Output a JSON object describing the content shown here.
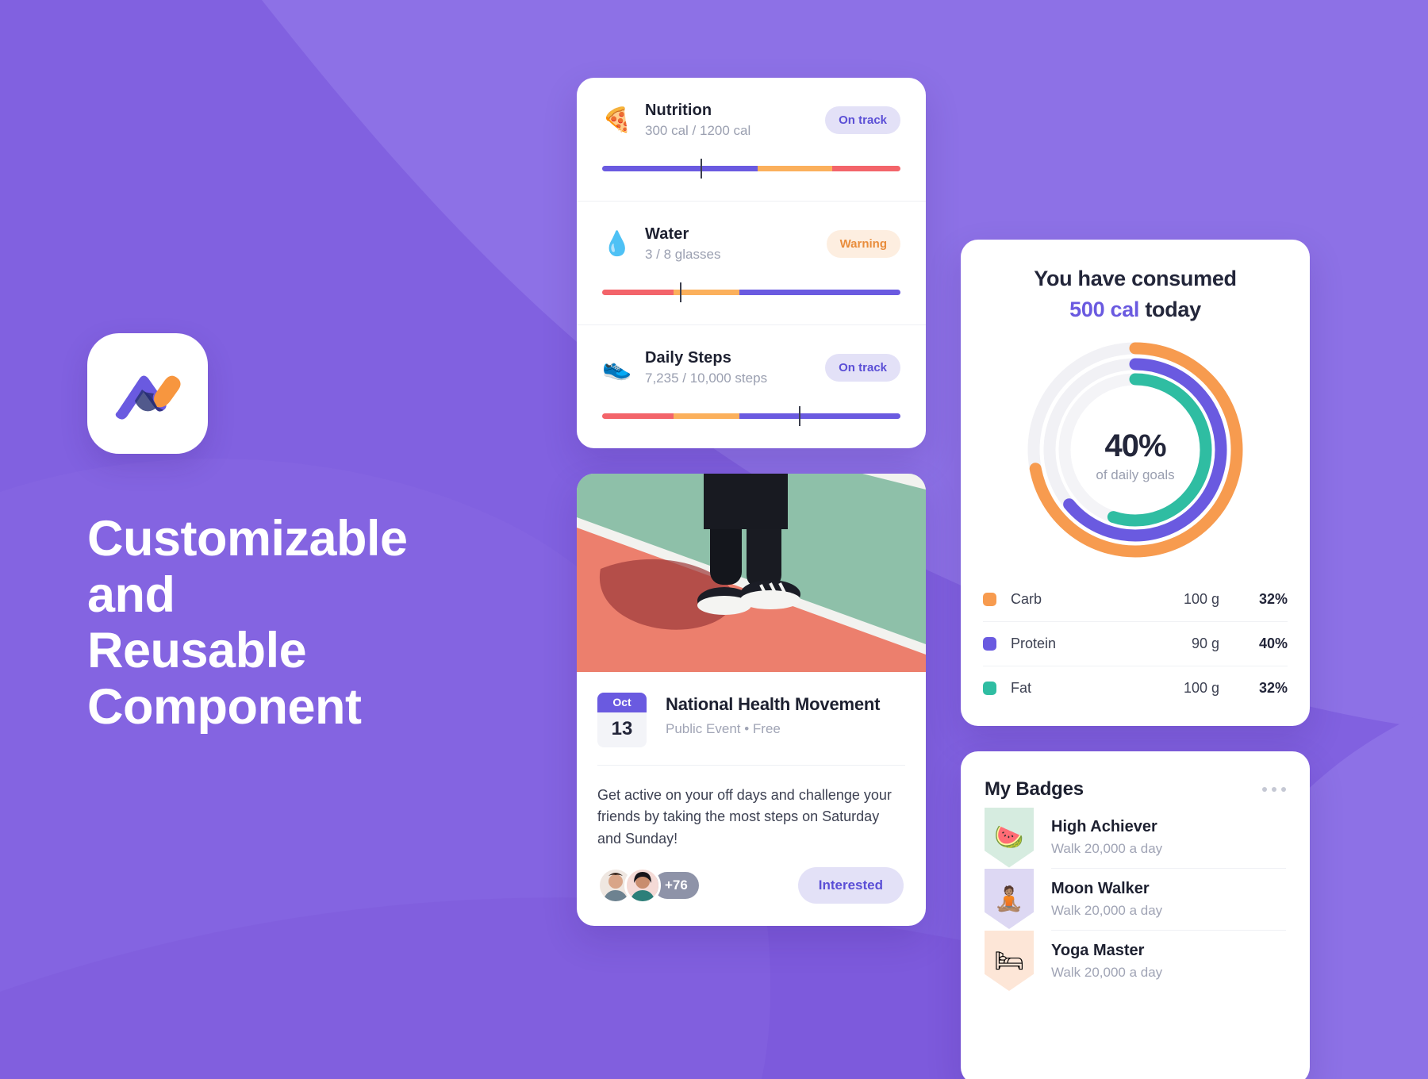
{
  "theme": {
    "bg_purple": "#8161e0",
    "bg_purple_dark": "#7a55d8",
    "bg_purple_light": "#8d71e6",
    "accent": "#6a5ae0",
    "orange": "#f79b4f",
    "teal": "#2fbda2",
    "red": "#f3646a",
    "amber": "#fbb05c"
  },
  "hero": {
    "logo_name": "app-logo-chevron",
    "title_lines": [
      "Customizable",
      "and",
      "Reusable",
      "Component"
    ]
  },
  "tracker": {
    "rows": [
      {
        "icon": "🍕",
        "icon_name": "pizza-icon",
        "name": "Nutrition",
        "sub": "300 cal / 1200 cal",
        "status": "On track",
        "status_kind": "ontrack",
        "marker_pct": 33,
        "segments": [
          {
            "color": "#6a5ae0",
            "pct": 52
          },
          {
            "color": "#fbb05c",
            "pct": 25
          },
          {
            "color": "#f3646a",
            "pct": 23
          }
        ]
      },
      {
        "icon": "💧",
        "icon_name": "water-drop-icon",
        "name": "Water",
        "sub": "3 / 8 glasses",
        "status": "Warning",
        "status_kind": "warning",
        "marker_pct": 26,
        "segments": [
          {
            "color": "#f3646a",
            "pct": 24
          },
          {
            "color": "#fbb05c",
            "pct": 22
          },
          {
            "color": "#6a5ae0",
            "pct": 54
          }
        ]
      },
      {
        "icon": "👟",
        "icon_name": "sneaker-icon",
        "name": "Daily Steps",
        "sub": "7,235 / 10,000 steps",
        "status": "On track",
        "status_kind": "ontrack",
        "marker_pct": 66,
        "segments": [
          {
            "color": "#f3646a",
            "pct": 24
          },
          {
            "color": "#fbb05c",
            "pct": 22
          },
          {
            "color": "#6a5ae0",
            "pct": 54
          }
        ]
      }
    ]
  },
  "event": {
    "photo_alt": "person standing on sports court",
    "month": "Oct",
    "day": "13",
    "title": "National Health Movement",
    "subtitle": "Public Event • Free",
    "description": "Get active on your off days and challenge your friends by taking the most steps on Saturday and Sunday!",
    "extra_attendees": "+76",
    "cta_label": "Interested"
  },
  "calories": {
    "line1": "You have consumed",
    "amount": "500 cal",
    "line1_tail": " today",
    "percent": "40%",
    "percent_caption": "of daily goals",
    "legend_rows": [
      {
        "color": "#f79b4f",
        "label": "Carb",
        "amount": "100 g",
        "pct": "32%",
        "ring_pct": 72
      },
      {
        "color": "#6a5ae0",
        "label": "Protein",
        "amount": "90 g",
        "pct": "40%",
        "ring_pct": 64
      },
      {
        "color": "#2fbda2",
        "label": "Fat",
        "amount": "100 g",
        "pct": "32%",
        "ring_pct": 55
      }
    ]
  },
  "badges": {
    "title": "My Badges",
    "menu_name": "more-options-icon",
    "items": [
      {
        "icon": "🍉",
        "icon_name": "watermelon-icon",
        "tint": "#d6ece0",
        "name": "High Achiever",
        "sub": "Walk 20,000 a day"
      },
      {
        "icon": "🧘🏽",
        "icon_name": "meditation-icon",
        "tint": "#ddd8f3",
        "name": "Moon Walker",
        "sub": "Walk 20,000 a day"
      },
      {
        "icon": "🛏",
        "icon_name": "bed-icon",
        "tint": "#fde6d7",
        "name": "Yoga Master",
        "sub": "Walk 20,000 a day"
      }
    ]
  },
  "chart_data": {
    "type": "pie",
    "title": "You have consumed 500 cal today",
    "center_label": "40%",
    "center_sublabel": "of daily goals",
    "legend_position": "below",
    "series": [
      {
        "name": "Carb",
        "grams": 100,
        "percent": 32,
        "color": "#f79b4f",
        "ring": "outer",
        "arc_fraction": 0.72
      },
      {
        "name": "Protein",
        "grams": 90,
        "percent": 40,
        "color": "#6a5ae0",
        "ring": "middle",
        "arc_fraction": 0.64
      },
      {
        "name": "Fat",
        "grams": 100,
        "percent": 32,
        "color": "#2fbda2",
        "ring": "inner",
        "arc_fraction": 0.55
      }
    ]
  }
}
